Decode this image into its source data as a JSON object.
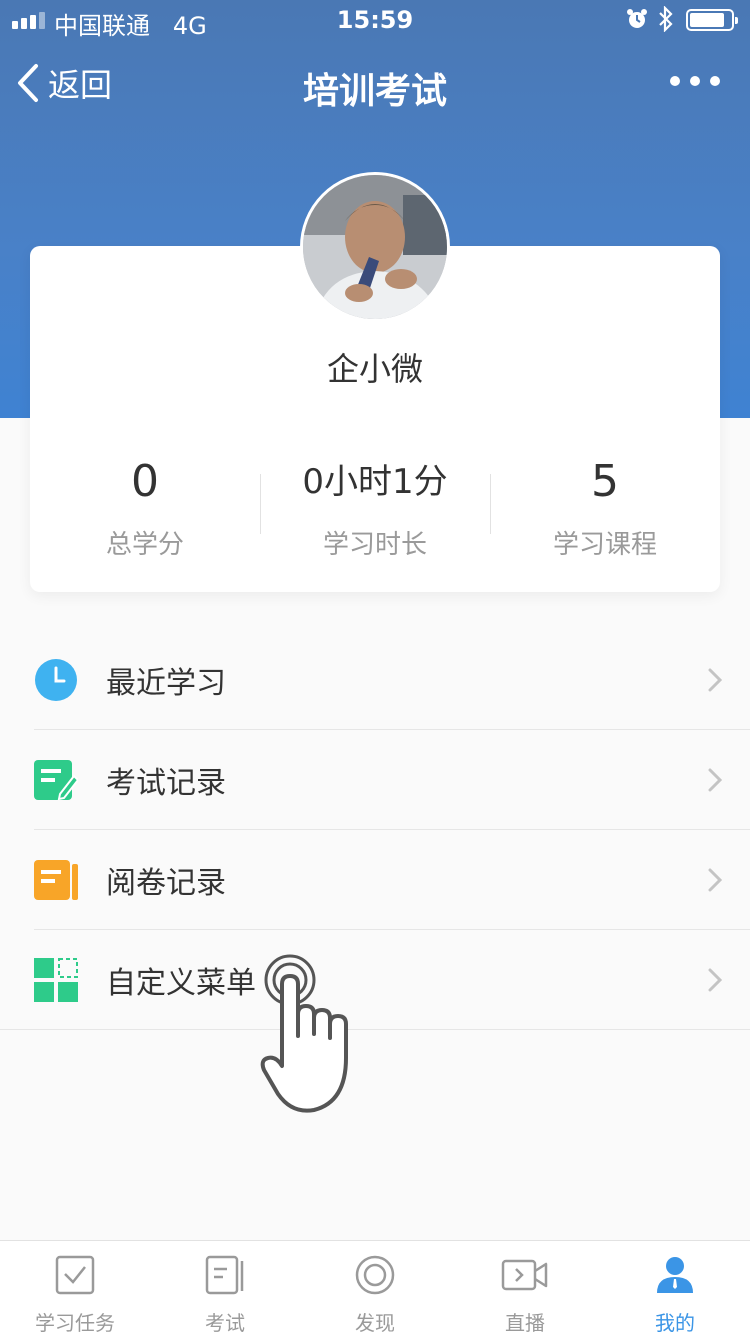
{
  "status_bar": {
    "carrier": "中国联通",
    "network": "4G",
    "time": "15:59"
  },
  "nav": {
    "back_label": "返回",
    "title": "培训考试"
  },
  "profile": {
    "name": "企小微"
  },
  "stats": [
    {
      "value": "0",
      "label": "总学分"
    },
    {
      "value": "0小时1分",
      "label": "学习时长"
    },
    {
      "value": "5",
      "label": "学习课程"
    }
  ],
  "menu": [
    {
      "label": "最近学习",
      "icon": "clock-icon",
      "color": "#3fb2f0"
    },
    {
      "label": "考试记录",
      "icon": "exam-record-icon",
      "color": "#2ecb8a"
    },
    {
      "label": "阅卷记录",
      "icon": "marking-record-icon",
      "color": "#f8a528"
    },
    {
      "label": "自定义菜单",
      "icon": "custom-menu-icon",
      "color": "#2ecb8a"
    }
  ],
  "tabbar": [
    {
      "label": "学习任务",
      "icon": "checkbox-icon"
    },
    {
      "label": "考试",
      "icon": "exam-icon"
    },
    {
      "label": "发现",
      "icon": "discover-icon"
    },
    {
      "label": "直播",
      "icon": "video-icon"
    },
    {
      "label": "我的",
      "icon": "user-icon",
      "active": true
    }
  ],
  "colors": {
    "header": "#4a7bc0",
    "accent": "#3b95e6",
    "text": "#333333",
    "muted": "#9a9a9a"
  }
}
